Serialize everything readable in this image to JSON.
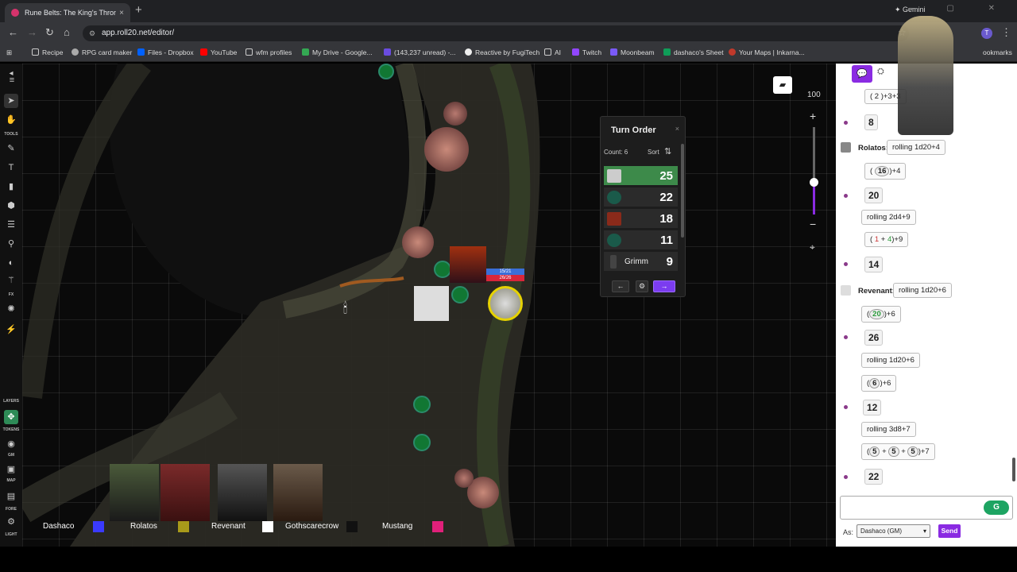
{
  "browser": {
    "tab_title": "Rune Belts: The King's Throne |",
    "tab_close": "×",
    "new_tab": "+",
    "gemini": "✦ Gemini",
    "url": "app.roll20.net/editor/",
    "profile": "T",
    "bookmarks": [
      "Recipe",
      "RPG card maker",
      "Files - Dropbox",
      "YouTube",
      "wfm profiles",
      "My Drive - Google...",
      "(143,237 unread) -...",
      "Reactive by FugiTech",
      "AI",
      "Twitch",
      "Moonbeam",
      "dashaco's Sheet",
      "Your Maps | Inkarna..."
    ],
    "bookmarks_more": "ookmarks"
  },
  "toolbar": {
    "labels": {
      "tools": "TOOLS",
      "fx": "FX",
      "layers": "LAYERS",
      "tokens": "TOKENS",
      "gm": "GM",
      "map": "MAP",
      "fore": "FORE",
      "light": "LIGHT"
    }
  },
  "map": {
    "token_hp_1": "15/21",
    "token_hp_2": "26/26"
  },
  "turn_order": {
    "title": "Turn Order",
    "close": "×",
    "count": "Count: 6",
    "sort": "Sort",
    "rows": [
      {
        "name": "",
        "value": "25",
        "active": true
      },
      {
        "name": "",
        "value": "22",
        "active": false
      },
      {
        "name": "",
        "value": "18",
        "active": false
      },
      {
        "name": "",
        "value": "11",
        "active": false
      },
      {
        "name": "Grimm",
        "value": "9",
        "active": false
      }
    ],
    "prev": "←",
    "settings": "⚙",
    "next": "→"
  },
  "zoom": {
    "value": "100",
    "plus": "+",
    "minus": "−"
  },
  "players": [
    {
      "name": "Dashaco",
      "color": "#3a3aff"
    },
    {
      "name": "Rolatos",
      "color": "#a89a1a"
    },
    {
      "name": "Revenant",
      "color": "#ffffff"
    },
    {
      "name": "Gothscarecrow",
      "color": "#111111"
    },
    {
      "name": "Mustang",
      "color": "#e0207a"
    }
  ],
  "chat": {
    "messages": {
      "m1_roll": "( 2 )+3+3",
      "m1_result": "8",
      "m2_who": "Rolatos:",
      "m2_text": "rolling 1d20+4",
      "m2_roll_die": "16",
      "m2_roll_mod": ")+4",
      "m2_result": "20",
      "m3_text": "rolling 2d4+9",
      "m3_d1": "1",
      "m3_d2": "4",
      "m3_mod": ")+9",
      "m3_result": "14",
      "m4_who": "Revenant:",
      "m4_text": "rolling 1d20+6",
      "m4_die": "20",
      "m4_mod": ")+6",
      "m4_result": "26",
      "m5_text": "rolling 1d20+6",
      "m5_die": "6",
      "m5_mod": ")+6",
      "m5_result": "12",
      "m6_text": "rolling 3d8+7",
      "m6_d1": "5",
      "m6_d2": "5",
      "m6_d3": "5",
      "m6_mod": ")+7",
      "m6_result": "22"
    },
    "as_label": "As:",
    "as_value": "Dashaco (GM)",
    "send": "Send"
  }
}
